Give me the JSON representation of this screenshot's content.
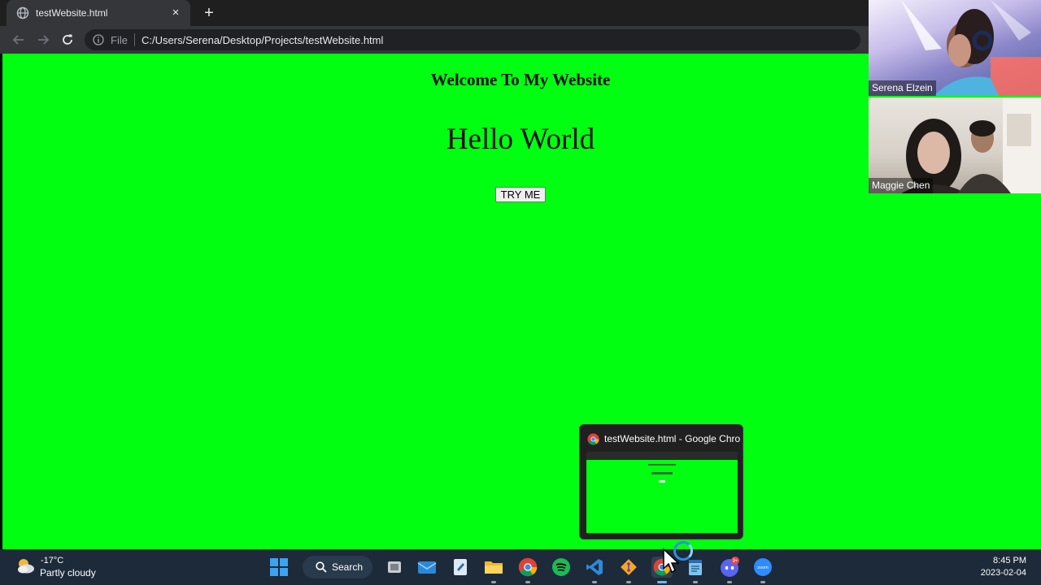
{
  "browser": {
    "tab_title": "testWebsite.html",
    "close_label": "×",
    "new_tab_label": "+",
    "file_label": "File",
    "url": "C:/Users/Serena/Desktop/Projects/testWebsite.html"
  },
  "page": {
    "heading": "Welcome To My Website",
    "hello": "Hello World",
    "button_label": "TRY ME",
    "background_color": "#00ff11"
  },
  "participants": [
    {
      "name": "Serena Elzein"
    },
    {
      "name": "Maggie Chen"
    }
  ],
  "preview": {
    "title": "testWebsite.html - Google Chro..."
  },
  "taskbar": {
    "weather_temp": "-17°C",
    "weather_desc": "Partly cloudy",
    "search_label": "Search",
    "discord_badge": "9+",
    "zoom_label": "zoom",
    "time": "8:45 PM",
    "date": "2023-02-04"
  },
  "icons": [
    "globe-icon",
    "close-icon",
    "plus-icon",
    "back-arrow-icon",
    "forward-arrow-icon",
    "reload-icon",
    "info-icon",
    "windows-start-icon",
    "search-icon",
    "task-view-icon",
    "mail-icon",
    "notepad-icon",
    "file-explorer-icon",
    "chrome-icon",
    "spotify-icon",
    "vscode-icon",
    "git-icon",
    "notes-icon",
    "discord-icon",
    "zoom-icon",
    "weather-icon",
    "mouse-cursor-icon",
    "loading-spinner-icon"
  ]
}
